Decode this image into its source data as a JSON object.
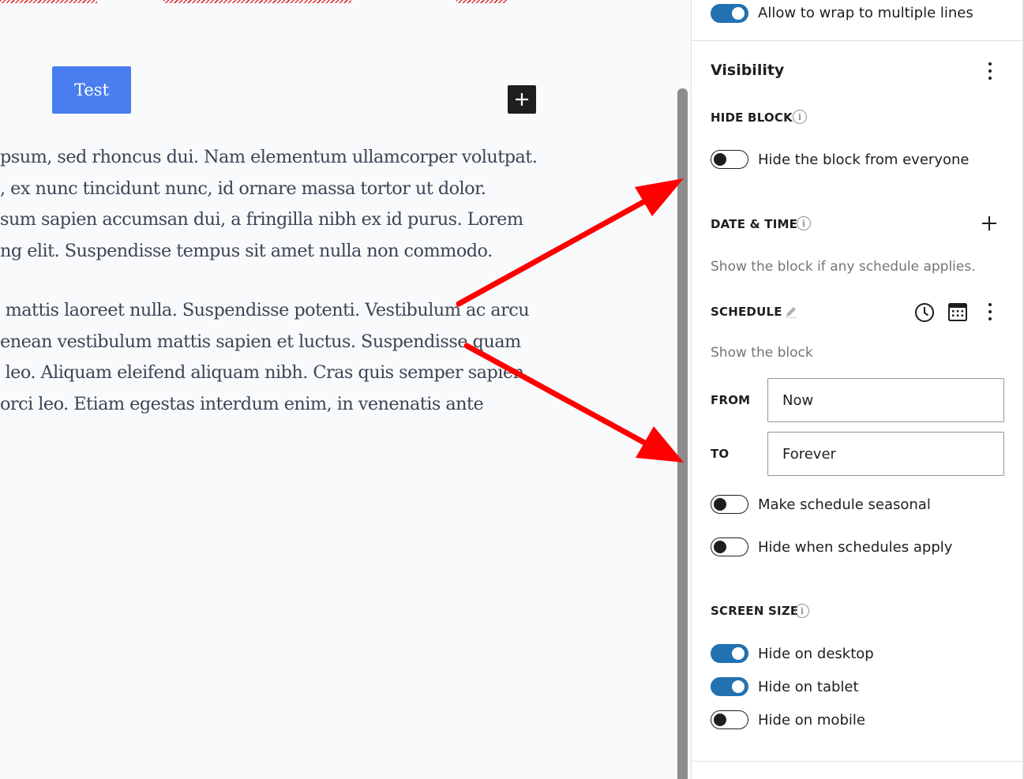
{
  "editor": {
    "button_label": "Test",
    "paragraph1": [
      "psum, sed rhoncus dui. Nam elementum ullamcorper volutpat.",
      ", ex nunc tincidunt nunc, id ornare massa tortor ut dolor.",
      "sum sapien accumsan dui, a fringilla nibh ex id purus. Lorem",
      "ng elit. Suspendisse tempus sit amet nulla non commodo."
    ],
    "paragraph2": [
      " mattis laoreet nulla. Suspendisse potenti. Vestibulum ac arcu",
      "enean vestibulum mattis sapien et luctus. Suspendisse quam",
      " leo. Aliquam eleifend aliquam nibh. Cras quis semper sapien.",
      "orci leo. Etiam egestas interdum enim, in venenatis ante"
    ]
  },
  "sidebar": {
    "wrap_toggle": {
      "label": "Allow to wrap to multiple lines",
      "checked": true
    },
    "visibility_title": "Visibility",
    "hide_block": {
      "heading": "HIDE BLOCK",
      "toggle_label": "Hide the block from everyone",
      "checked": false
    },
    "date_time": {
      "heading": "DATE & TIME",
      "help": "Show the block if any schedule applies.",
      "schedule_heading": "SCHEDULE",
      "schedule_help": "Show the block",
      "from_label": "FROM",
      "from_value": "Now",
      "to_label": "TO",
      "to_value": "Forever",
      "seasonal_label": "Make schedule seasonal",
      "seasonal_checked": false,
      "hide_when_label": "Hide when schedules apply",
      "hide_when_checked": false
    },
    "screen_size": {
      "heading": "SCREEN SIZE",
      "desktop_label": "Hide on desktop",
      "desktop_checked": true,
      "tablet_label": "Hide on tablet",
      "tablet_checked": true,
      "mobile_label": "Hide on mobile",
      "mobile_checked": false
    }
  },
  "colors": {
    "toggle_on": "#2271b1",
    "button_blue": "#4a7ef0",
    "annotation_arrow": "#ff0000"
  },
  "icons": [
    "plus-icon",
    "info-icon",
    "pencil-icon",
    "clock-icon",
    "calendar-icon",
    "more-vertical-icon"
  ]
}
